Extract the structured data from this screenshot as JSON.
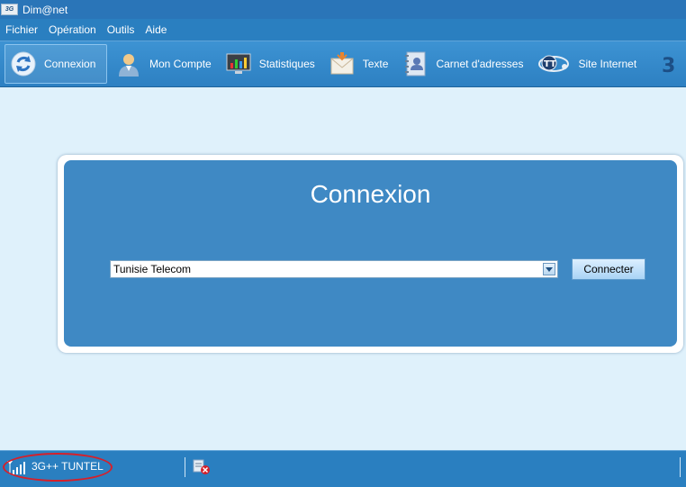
{
  "window": {
    "title": "Dim@net",
    "app_icon_text": "3G"
  },
  "menu": [
    "Fichier",
    "Opération",
    "Outils",
    "Aide"
  ],
  "toolbar": [
    {
      "label": "Connexion",
      "icon": "refresh-icon",
      "active": true
    },
    {
      "label": "Mon Compte",
      "icon": "user-icon"
    },
    {
      "label": "Statistiques",
      "icon": "monitor-chart-icon"
    },
    {
      "label": "Texte",
      "icon": "envelope-icon"
    },
    {
      "label": "Carnet d'adresses",
      "icon": "address-book-icon"
    },
    {
      "label": "Site Internet",
      "icon": "tunisie-telecom-logo-icon"
    }
  ],
  "panel": {
    "title": "Connexion",
    "profile_value": "Tunisie Telecom",
    "connect_label": "Connecter"
  },
  "status": {
    "network": "3G++  TUNTEL",
    "highlight_color": "#d6202a"
  },
  "colors": {
    "bar": "#2a7fc0",
    "panel": "#3f89c4",
    "background": "#dff1fb"
  }
}
